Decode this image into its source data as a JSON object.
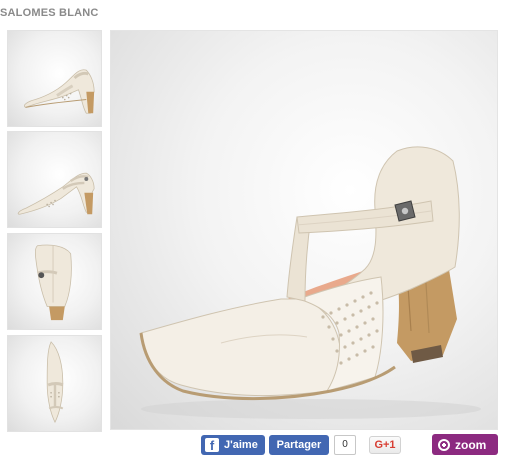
{
  "product": {
    "title": "SALOMES BLANC"
  },
  "thumbnails": [
    {
      "view": "side"
    },
    {
      "view": "side-alt"
    },
    {
      "view": "back"
    },
    {
      "view": "top"
    }
  ],
  "main_image": {
    "view": "three-quarter"
  },
  "social": {
    "fb_like_label": "J'aime",
    "fb_share_label": "Partager",
    "share_count": "0",
    "gplus_label": "G+1"
  },
  "zoom": {
    "label": "zoom",
    "icon": "zoom-in-icon"
  },
  "colors": {
    "facebook": "#4267b2",
    "zoom": "#8c2a80",
    "gplus": "#d73d32",
    "shoe": "#efe8db",
    "heel": "#c49a63"
  }
}
